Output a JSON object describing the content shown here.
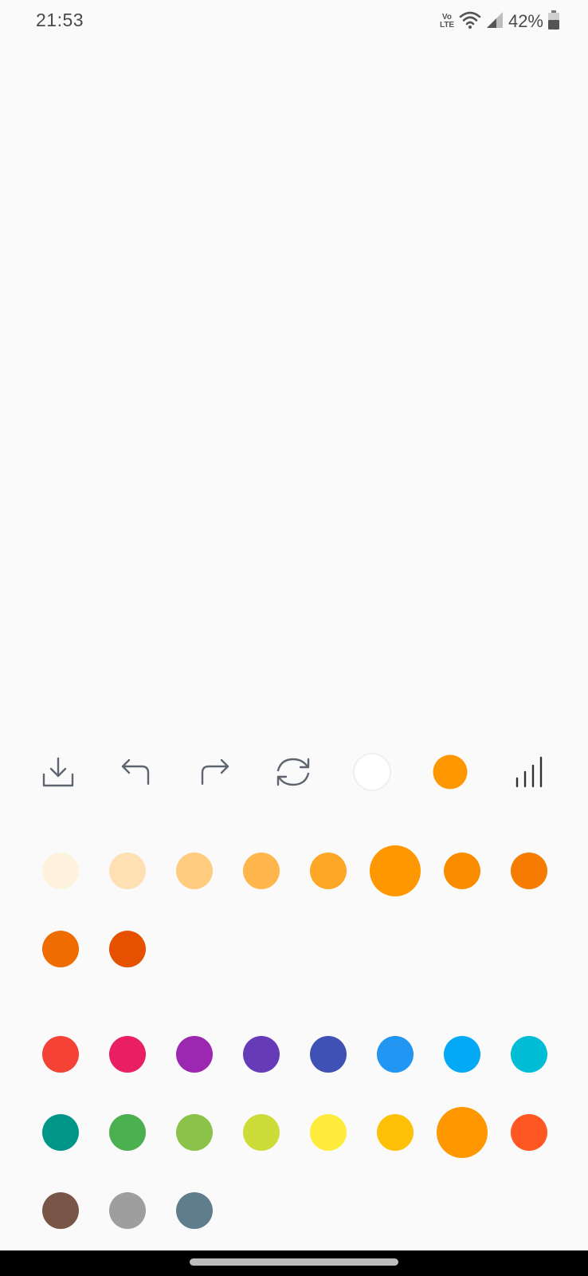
{
  "status_bar": {
    "time": "21:53",
    "network_label_top": "Vo",
    "network_label_bottom": "LTE",
    "battery_percent": "42%"
  },
  "toolbar": {
    "icons": [
      "download-icon",
      "undo-icon",
      "redo-icon",
      "refresh-icon",
      "eraser-circle-icon",
      "current-color-icon",
      "brush-size-icon"
    ],
    "current_color": "#FF9800"
  },
  "shade_palette": {
    "selected": "#FF9800",
    "colors": [
      "#FFF3E0",
      "#FFE0B2",
      "#FFCC80",
      "#FFB74D",
      "#FFA726",
      "#FF9800",
      "#FB8C00",
      "#F57C00",
      "#EF6C00",
      "#E65100"
    ]
  },
  "main_palette": {
    "selected": "#FF9800",
    "colors": [
      "#F44336",
      "#E91E63",
      "#9C27B0",
      "#673AB7",
      "#3F51B5",
      "#2196F3",
      "#03A9F4",
      "#00BCD4",
      "#009688",
      "#4CAF50",
      "#8BC34A",
      "#CDDC39",
      "#FFEB3B",
      "#FFC107",
      "#FF9800",
      "#FF5722",
      "#795548",
      "#9E9E9E",
      "#607D8B"
    ]
  }
}
